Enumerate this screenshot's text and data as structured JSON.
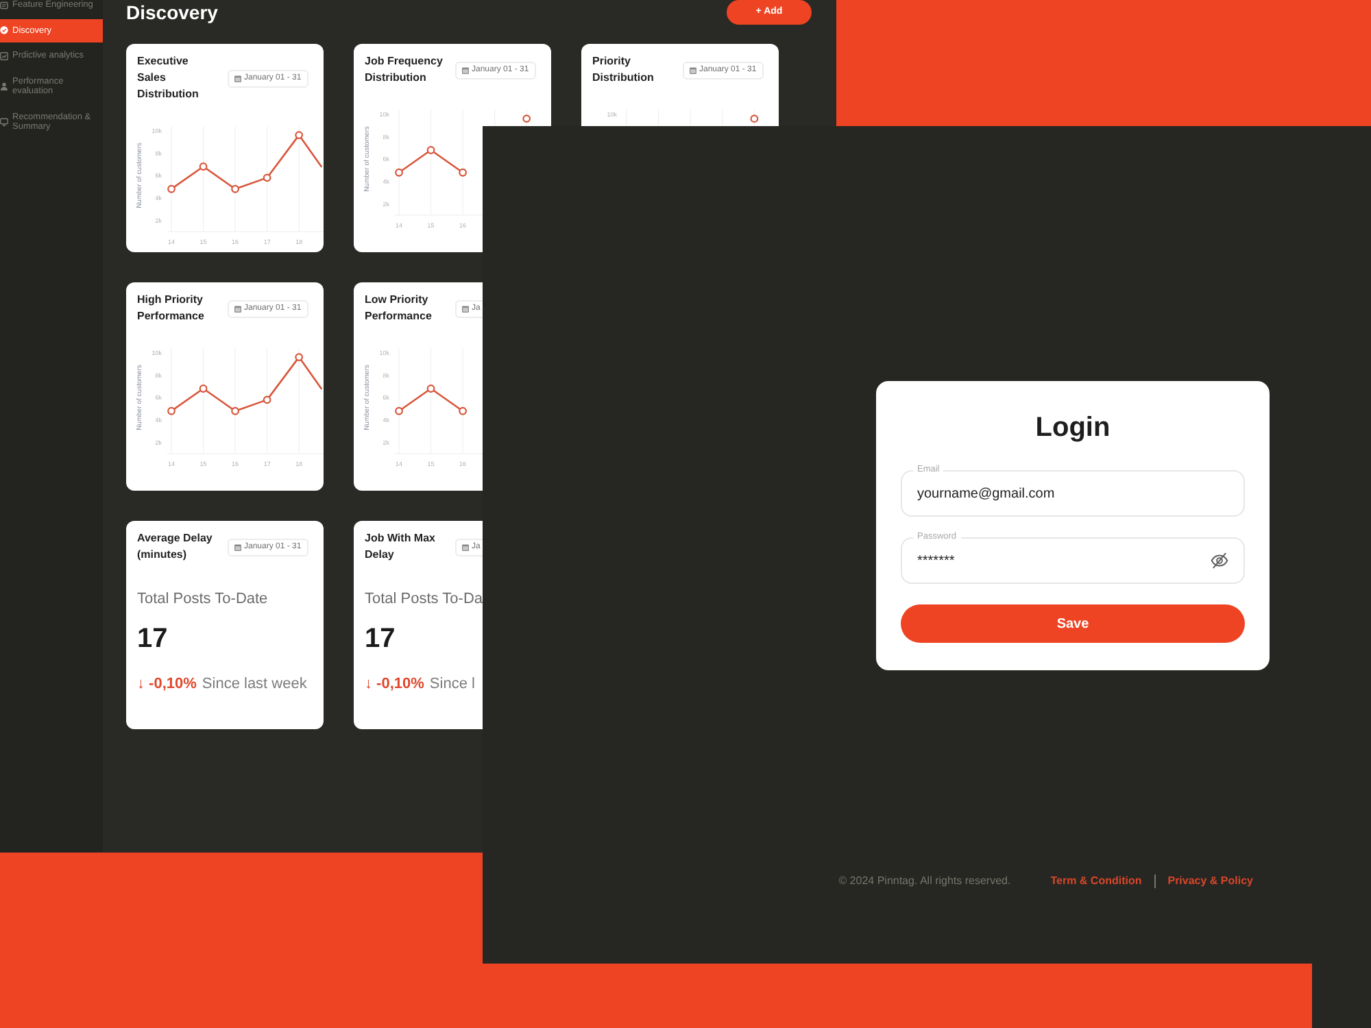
{
  "dashboard": {
    "sidebar": {
      "items": [
        {
          "label": "Feature Engineering",
          "selected": false
        },
        {
          "label": "Discovery",
          "selected": true
        },
        {
          "label": "Prdictive analytics",
          "selected": false
        },
        {
          "label": "Performance evaluation",
          "selected": false
        },
        {
          "label": "Recommendation & Summary",
          "selected": false
        }
      ]
    },
    "header": {
      "title": "Discovery",
      "add_button": "+ Add"
    },
    "card_rows": [
      [
        {
          "kind": "chart",
          "title": "Executive Sales Distribution",
          "date": "January 01 - 31",
          "chart_data": {
            "type": "line",
            "ylabel": "Number of customers",
            "x": [
              14,
              15,
              16,
              17,
              18,
              18.7
            ],
            "xticks": [
              14,
              15,
              16,
              17,
              18
            ],
            "xlim": [
              13.87,
              18.77
            ],
            "yticks": [
              {
                "value": 2000,
                "label": "2k"
              },
              {
                "value": 4000,
                "label": "4k"
              },
              {
                "value": 6000,
                "label": "6k"
              },
              {
                "value": 8000,
                "label": "8k"
              },
              {
                "value": 10000,
                "label": "10k"
              }
            ],
            "ylim": [
              1000,
              10400
            ],
            "grid": true,
            "marker": "circle",
            "series": [
              {
                "color": "#d9553b",
                "values": [
                  4800,
                  6800,
                  4800,
                  5800,
                  9600,
                  6800
                ]
              }
            ]
          }
        },
        {
          "kind": "chart",
          "title": "Job Frequency Distribution",
          "date": "January 01 - 31",
          "chart_data": {
            "type": "line",
            "ylabel": "Number of customers",
            "x": [
              14,
              15,
              16,
              17,
              18
            ],
            "xticks": [
              14,
              15,
              16
            ],
            "xlim": [
              13.87,
              18.77
            ],
            "yticks": [
              {
                "value": 2000,
                "label": "2k"
              },
              {
                "value": 4000,
                "label": "4k"
              },
              {
                "value": 6000,
                "label": "6k"
              },
              {
                "value": 8000,
                "label": "8k"
              },
              {
                "value": 10000,
                "label": "10k"
              }
            ],
            "ylim": [
              1000,
              10400
            ],
            "grid": true,
            "marker": "circle",
            "series": [
              {
                "color": "#d9553b",
                "values": [
                  4800,
                  6800,
                  4800,
                  null,
                  9600
                ]
              }
            ]
          }
        },
        {
          "kind": "chart_fragment",
          "title": "Priority Distribution",
          "date": "January 01 - 31",
          "tick_label": "10k"
        }
      ],
      [
        {
          "kind": "chart",
          "title": "High Priority Performance",
          "date": "January 01 - 31",
          "chart_data": {
            "type": "line",
            "ylabel": "Number of customers",
            "x": [
              14,
              15,
              16,
              17,
              18,
              18.7
            ],
            "xticks": [
              14,
              15,
              16,
              17,
              18
            ],
            "xlim": [
              13.87,
              18.77
            ],
            "yticks": [
              {
                "value": 2000,
                "label": "2k"
              },
              {
                "value": 4000,
                "label": "4k"
              },
              {
                "value": 6000,
                "label": "6k"
              },
              {
                "value": 8000,
                "label": "8k"
              },
              {
                "value": 10000,
                "label": "10k"
              }
            ],
            "ylim": [
              1000,
              10400
            ],
            "grid": true,
            "marker": "circle",
            "series": [
              {
                "color": "#d9553b",
                "values": [
                  4800,
                  6800,
                  4800,
                  5800,
                  9600,
                  6800
                ]
              }
            ]
          }
        },
        {
          "kind": "chart",
          "title": "Low Priority Performance",
          "date": "Ja",
          "chart_data": {
            "type": "line",
            "ylabel": "Number of customers",
            "x": [
              14,
              15,
              16
            ],
            "xticks": [
              14,
              15,
              16
            ],
            "xlim": [
              13.87,
              18.77
            ],
            "yticks": [
              {
                "value": 2000,
                "label": "2k"
              },
              {
                "value": 4000,
                "label": "4k"
              },
              {
                "value": 6000,
                "label": "6k"
              },
              {
                "value": 8000,
                "label": "8k"
              },
              {
                "value": 10000,
                "label": "10k"
              }
            ],
            "ylim": [
              1000,
              10400
            ],
            "grid": true,
            "marker": "circle",
            "series": [
              {
                "color": "#d9553b",
                "values": [
                  4800,
                  6800,
                  4800
                ]
              }
            ]
          }
        }
      ],
      [
        {
          "kind": "stat",
          "title": "Average Delay (minutes)",
          "date": "January 01 - 31",
          "metric_label": "Total Posts To-Date",
          "metric_value": "17",
          "change": "↓ -0,10%",
          "since": "Since last week"
        },
        {
          "kind": "stat",
          "title": "Job With Max Delay",
          "date": "Ja",
          "metric_label": "Total Posts To-Da",
          "metric_value": "17",
          "change": "↓ -0,10%",
          "since": "Since l"
        }
      ]
    ]
  },
  "login": {
    "title": "Login",
    "fields": [
      {
        "kind": "email",
        "label": "Email",
        "value": "yourname@gmail.com"
      },
      {
        "kind": "password",
        "label": "Password",
        "value": "*******"
      }
    ],
    "submit": "Save",
    "footer": {
      "copyright": "© 2024 Pinntag. All rights reserved.",
      "links": [
        "Term & Condition",
        "Privacy & Policy"
      ]
    }
  }
}
